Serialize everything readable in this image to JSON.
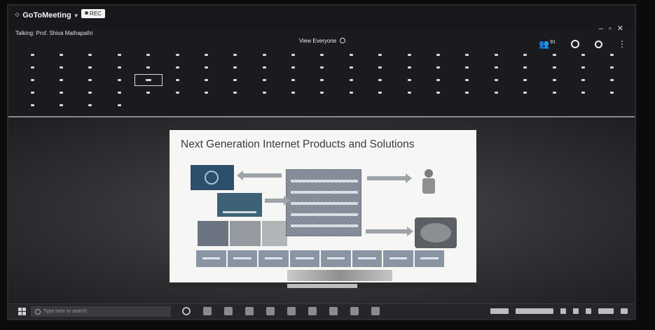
{
  "app": {
    "name": "GoToMeeting",
    "rec_label": "REC"
  },
  "header": {
    "talking": "Talking: Prof. Shiva Mathapathi",
    "view_label": "View Everyone",
    "participant_count": "91"
  },
  "slide": {
    "title": "Next Generation Internet Products and Solutions"
  },
  "taskbar": {
    "search_placeholder": "Type here to search"
  },
  "icons": {
    "participants": "people-icon",
    "search": "search-icon",
    "globe": "globe-icon",
    "more": "more-vertical-icon",
    "windows": "windows-logo-icon"
  }
}
